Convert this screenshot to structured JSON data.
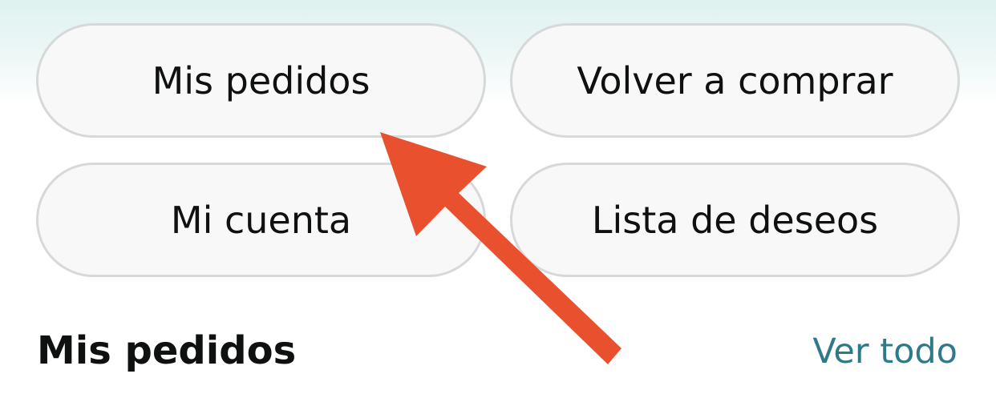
{
  "quick_actions": {
    "orders": "Mis pedidos",
    "buy_again": "Volver a comprar",
    "account": "Mi cuenta",
    "wishlist": "Lista de deseos"
  },
  "orders_section": {
    "title": "Mis pedidos",
    "see_all": "Ver todo"
  },
  "annotation": {
    "arrow_color": "#e9512e",
    "points_to": "Mis pedidos button"
  },
  "colors": {
    "link": "#2e7a88",
    "pill_border": "#d6d9d9",
    "pill_bg": "#f8f8f8",
    "text": "#0f1111"
  }
}
